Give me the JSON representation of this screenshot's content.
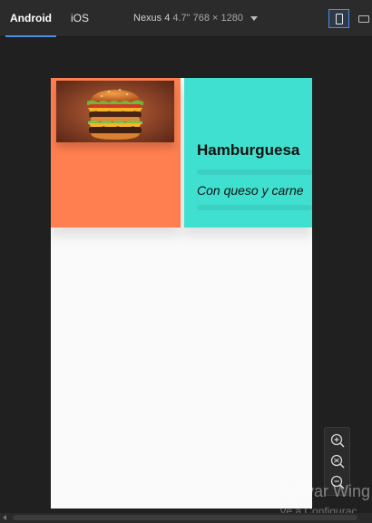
{
  "toolbar": {
    "tabs": [
      {
        "label": "Android",
        "active": true
      },
      {
        "label": "iOS",
        "active": false
      }
    ],
    "device_name": "Nexus 4",
    "device_dims": "4.7\" 768 × 1280",
    "accent_color": "#4a8fe0"
  },
  "screen": {
    "background": "#fafafa",
    "left_card_color": "#ff7f50",
    "right_card_color": "#40e0d0",
    "image_icon": "hamburger-image",
    "title": "Hamburguesa",
    "subtitle": "Con queso y carne"
  },
  "zoom_controls": {
    "icons": [
      "zoom-in-icon",
      "zoom-reset-icon",
      "zoom-out-icon"
    ]
  },
  "watermark": {
    "line1": "Activar Wing",
    "line2": "Ve a Configurac"
  }
}
